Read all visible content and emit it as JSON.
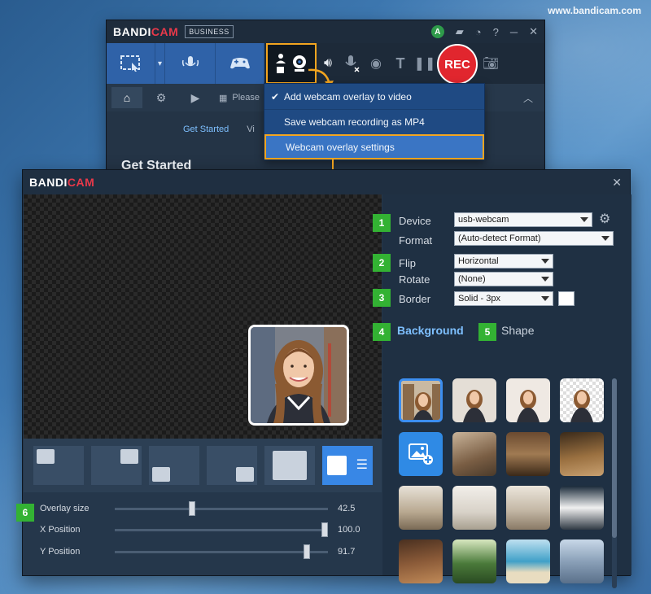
{
  "watermark": "www.bandicam.com",
  "main_window": {
    "logo_main": "BANDI",
    "logo_accent": "CAM",
    "edition": "BUSINESS",
    "avatar_letter": "A",
    "rec_label": "REC",
    "search_placeholder": "Please",
    "subtab_active": "Get Started",
    "subtab_next": "Vi",
    "heading": "Get Started"
  },
  "webcam_menu": {
    "items": [
      {
        "label": "Add webcam overlay to video",
        "checked": true
      },
      {
        "label": "Save webcam recording as MP4",
        "checked": false
      },
      {
        "label": "Webcam overlay settings",
        "checked": false
      }
    ]
  },
  "dialog": {
    "logo_main": "BANDI",
    "logo_accent": "CAM",
    "close_symbol": "✕",
    "device_label": "Device",
    "device_value": "usb-webcam",
    "format_label": "Format",
    "format_value": "(Auto-detect Format)",
    "flip_label": "Flip",
    "flip_value": "Horizontal",
    "rotate_label": "Rotate",
    "rotate_value": "(None)",
    "border_label": "Border",
    "border_value": "Solid - 3px",
    "border_color": "#ffffff",
    "tab_background": "Background",
    "tab_shape": "Shape",
    "badges": [
      "1",
      "2",
      "3",
      "4",
      "5",
      "6"
    ],
    "overlay_size_label": "Overlay size",
    "overlay_size_value": "42.5",
    "x_position_label": "X Position",
    "x_position_value": "100.0",
    "y_position_label": "Y Position",
    "y_position_value": "91.7"
  },
  "colors": {
    "accent": "#f3a51f",
    "badge": "#33b233",
    "highlight_blue": "#3a75c4",
    "rec_red": "#e1262e"
  }
}
